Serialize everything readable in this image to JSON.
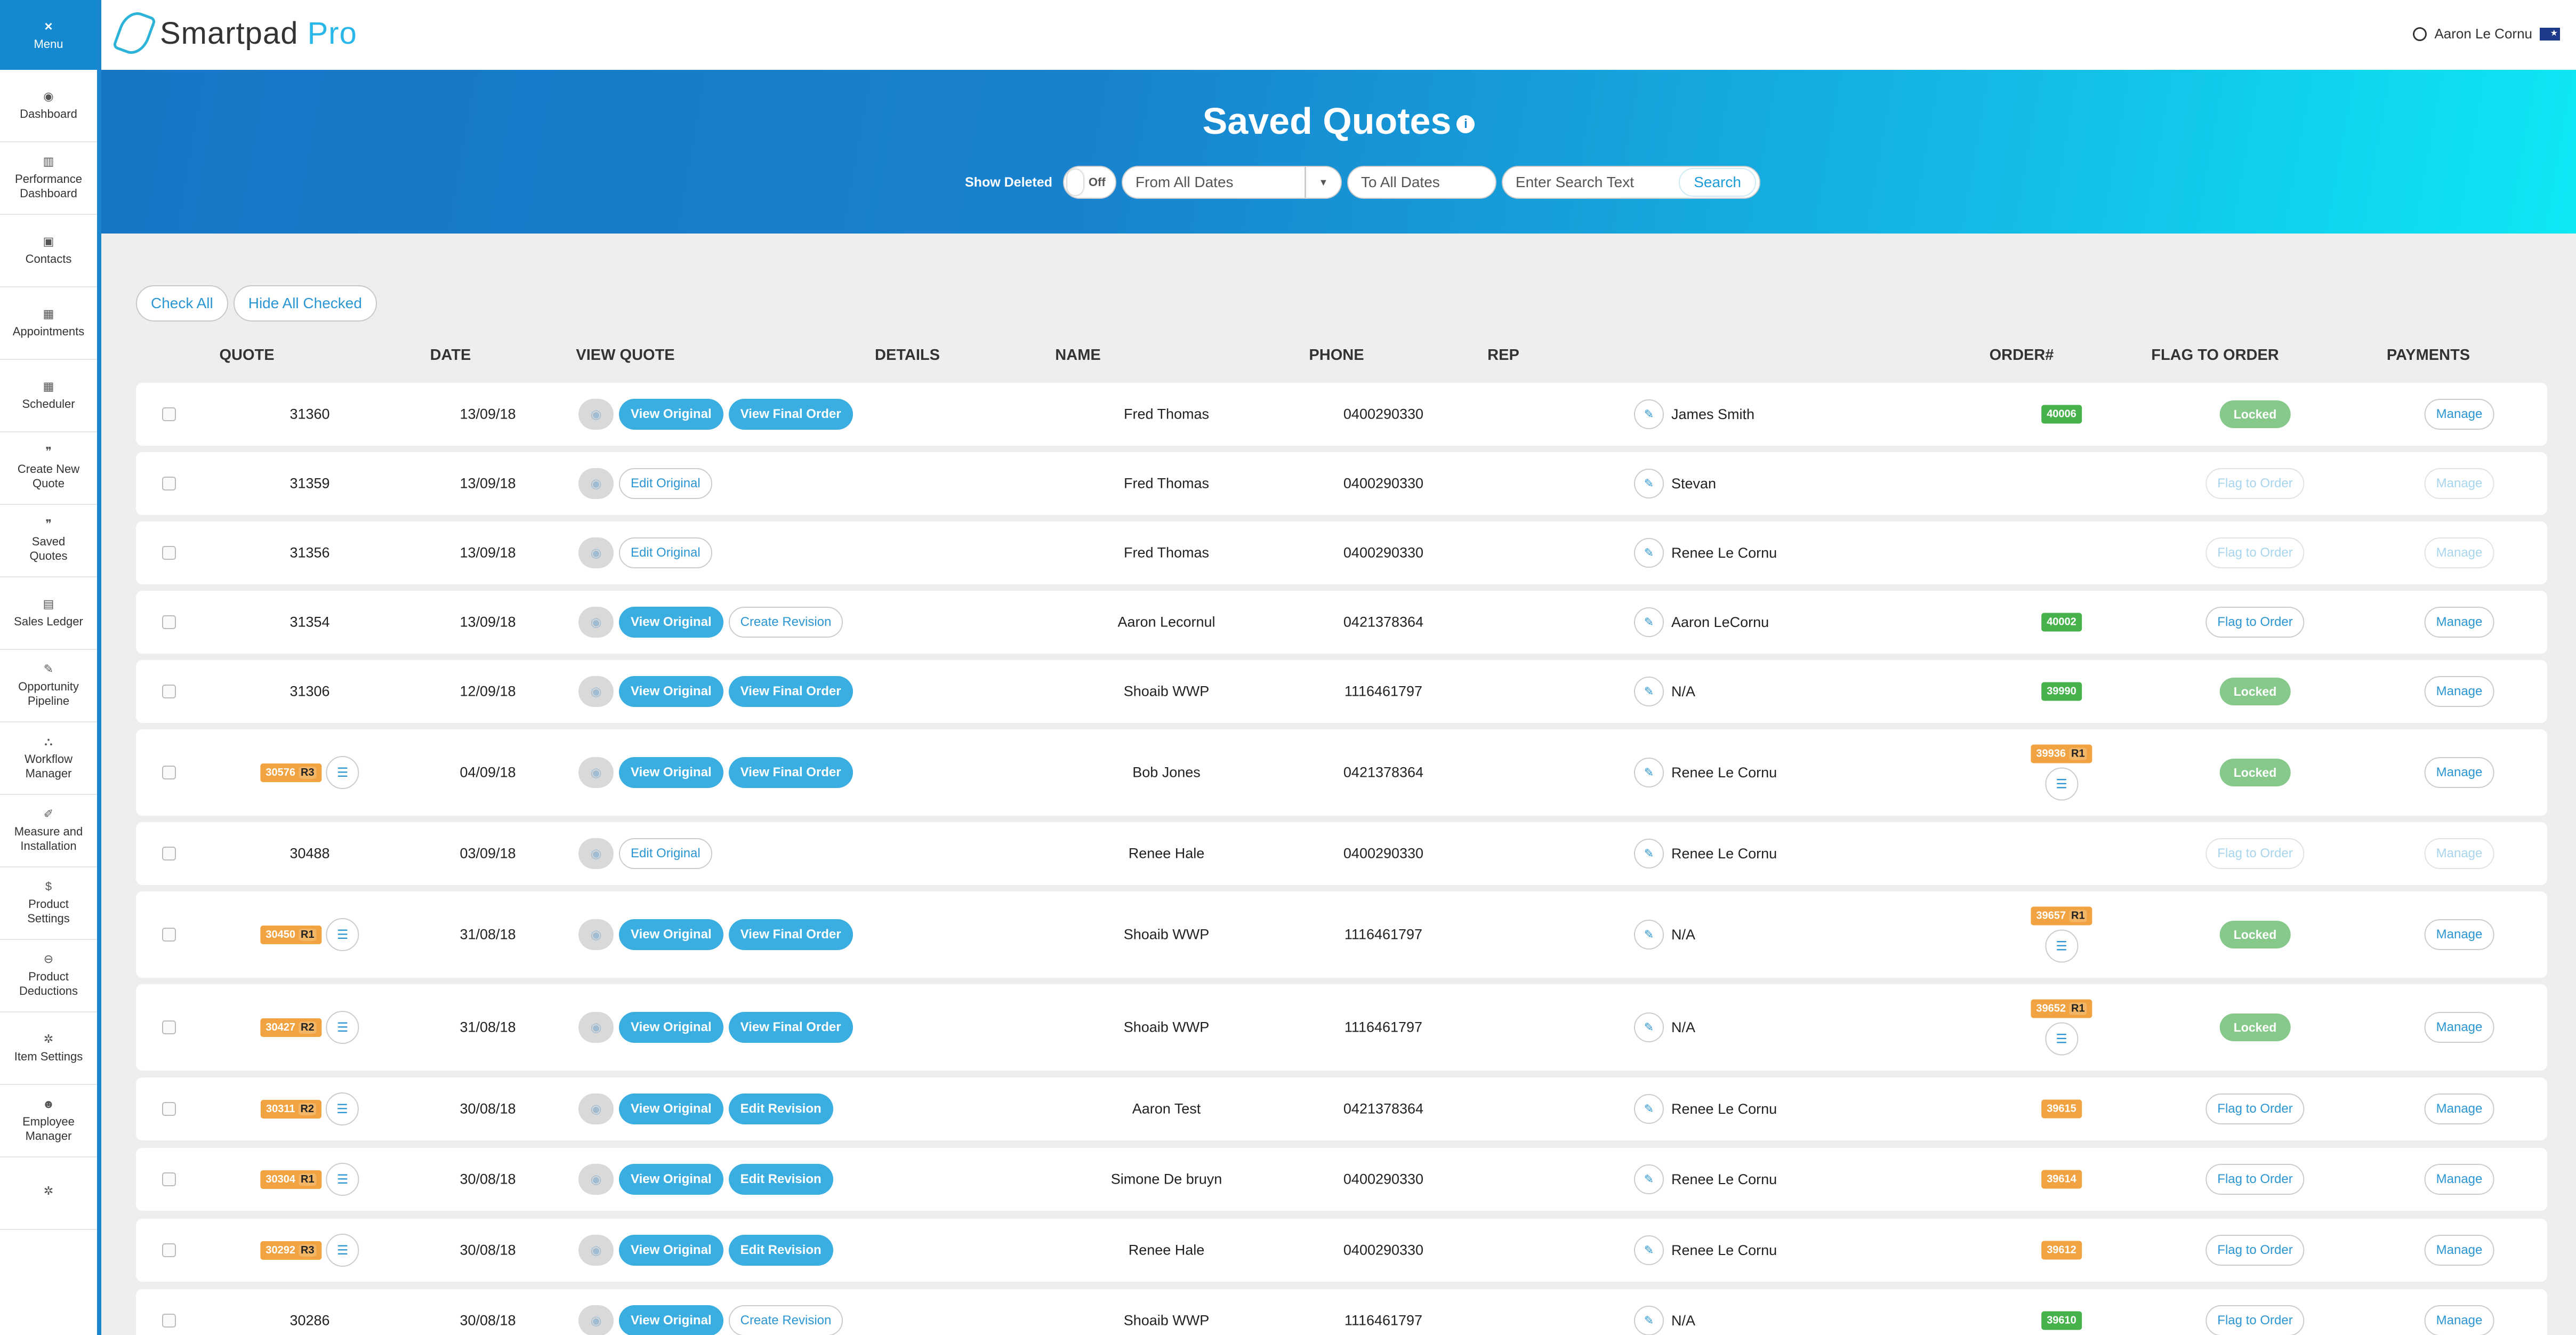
{
  "sidebar": {
    "menu_label": "Menu",
    "items": [
      {
        "label": "Dashboard",
        "icon": "dashboard-icon",
        "glyph": "◉"
      },
      {
        "label": "Performance\nDashboard",
        "icon": "chart-icon",
        "glyph": "▥"
      },
      {
        "label": "Contacts",
        "icon": "contacts-icon",
        "glyph": "▣"
      },
      {
        "label": "Appointments",
        "icon": "calendar-icon",
        "glyph": "▦"
      },
      {
        "label": "Scheduler",
        "icon": "calendar-icon",
        "glyph": "▦"
      },
      {
        "label": "Create New\nQuote",
        "icon": "quote-icon",
        "glyph": "❞"
      },
      {
        "label": "Saved\nQuotes",
        "icon": "quote-icon",
        "glyph": "❞"
      },
      {
        "label": "Sales Ledger",
        "icon": "book-icon",
        "glyph": "▤"
      },
      {
        "label": "Opportunity\nPipeline",
        "icon": "edit-icon",
        "glyph": "✎"
      },
      {
        "label": "Workflow\nManager",
        "icon": "sitemap-icon",
        "glyph": "⛬"
      },
      {
        "label": "Measure and\nInstallation",
        "icon": "wrench-icon",
        "glyph": "✐"
      },
      {
        "label": "Product\nSettings",
        "icon": "dollar-icon",
        "glyph": "$"
      },
      {
        "label": "Product\nDeductions",
        "icon": "minus-circle-icon",
        "glyph": "⊖"
      },
      {
        "label": "Item Settings",
        "icon": "gear-icon",
        "glyph": "✲"
      },
      {
        "label": "Employee\nManager",
        "icon": "users-icon",
        "glyph": "☻"
      },
      {
        "label": "",
        "icon": "gear-icon",
        "glyph": "✲"
      }
    ]
  },
  "topbar": {
    "logo_main": "Smartpad",
    "logo_pro": " Pro",
    "user_name": "Aaron Le Cornu",
    "flag_icon": "australia-flag-icon"
  },
  "banner": {
    "title": "Saved Quotes",
    "show_deleted_label": "Show Deleted",
    "toggle_state": "Off",
    "from_date": "From All Dates",
    "to_date": "To All Dates",
    "search_placeholder": "Enter Search Text",
    "search_button": "Search"
  },
  "toolbar": {
    "check_all": "Check All",
    "hide_all_checked": "Hide All Checked"
  },
  "columns": {
    "quote": "QUOTE",
    "date": "DATE",
    "view_quote": "VIEW QUOTE",
    "details": "DETAILS",
    "name": "NAME",
    "phone": "PHONE",
    "rep": "REP",
    "order": "ORDER#",
    "flag_to_order": "FLAG TO ORDER",
    "payments": "PAYMENTS"
  },
  "rows": [
    {
      "quote": "31360",
      "revision": "",
      "date": "13/09/18",
      "buttons": [
        {
          "label": "View Original",
          "style": "fill"
        },
        {
          "label": "View Final Order",
          "style": "fill"
        }
      ],
      "name": "Fred Thomas",
      "phone": "0400290330",
      "rep": "James Smith",
      "order": "40006",
      "order_color": "green",
      "order_rev": "",
      "flag": "Locked",
      "flag_style": "green",
      "payments": "Manage",
      "payments_dim": false
    },
    {
      "quote": "31359",
      "revision": "",
      "date": "13/09/18",
      "buttons": [
        {
          "label": "Edit Original",
          "style": "out"
        }
      ],
      "name": "Fred Thomas",
      "phone": "0400290330",
      "rep": "Stevan",
      "order": "",
      "order_color": "",
      "order_rev": "",
      "flag": "Flag to Order",
      "flag_style": "dim",
      "payments": "Manage",
      "payments_dim": true
    },
    {
      "quote": "31356",
      "revision": "",
      "date": "13/09/18",
      "buttons": [
        {
          "label": "Edit Original",
          "style": "out"
        }
      ],
      "name": "Fred Thomas",
      "phone": "0400290330",
      "rep": "Renee Le Cornu",
      "order": "",
      "order_color": "",
      "order_rev": "",
      "flag": "Flag to Order",
      "flag_style": "dim",
      "payments": "Manage",
      "payments_dim": true
    },
    {
      "quote": "31354",
      "revision": "",
      "date": "13/09/18",
      "buttons": [
        {
          "label": "View Original",
          "style": "fill"
        },
        {
          "label": "Create Revision",
          "style": "out"
        }
      ],
      "name": "Aaron Lecornul",
      "phone": "0421378364",
      "rep": "Aaron LeCornu",
      "order": "40002",
      "order_color": "green",
      "order_rev": "",
      "flag": "Flag to Order",
      "flag_style": "out",
      "payments": "Manage",
      "payments_dim": false
    },
    {
      "quote": "31306",
      "revision": "",
      "date": "12/09/18",
      "buttons": [
        {
          "label": "View Original",
          "style": "fill"
        },
        {
          "label": "View Final Order",
          "style": "fill"
        }
      ],
      "name": "Shoaib WWP",
      "phone": "1116461797",
      "rep": "N/A",
      "order": "39990",
      "order_color": "green",
      "order_rev": "",
      "flag": "Locked",
      "flag_style": "green",
      "payments": "Manage",
      "payments_dim": false
    },
    {
      "quote": "30576",
      "revision": "R3",
      "date": "04/09/18",
      "buttons": [
        {
          "label": "View Original",
          "style": "fill"
        },
        {
          "label": "View Final Order",
          "style": "fill"
        }
      ],
      "name": "Bob Jones",
      "phone": "0421378364",
      "rep": "Renee Le Cornu",
      "order": "39936",
      "order_color": "orange",
      "order_rev": "R1",
      "flag": "Locked",
      "flag_style": "green",
      "payments": "Manage",
      "payments_dim": false
    },
    {
      "quote": "30488",
      "revision": "",
      "date": "03/09/18",
      "buttons": [
        {
          "label": "Edit Original",
          "style": "out"
        }
      ],
      "name": "Renee Hale",
      "phone": "0400290330",
      "rep": "Renee Le Cornu",
      "order": "",
      "order_color": "",
      "order_rev": "",
      "flag": "Flag to Order",
      "flag_style": "dim",
      "payments": "Manage",
      "payments_dim": true
    },
    {
      "quote": "30450",
      "revision": "R1",
      "date": "31/08/18",
      "buttons": [
        {
          "label": "View Original",
          "style": "fill"
        },
        {
          "label": "View Final Order",
          "style": "fill"
        }
      ],
      "name": "Shoaib WWP",
      "phone": "1116461797",
      "rep": "N/A",
      "order": "39657",
      "order_color": "orange",
      "order_rev": "R1",
      "flag": "Locked",
      "flag_style": "green",
      "payments": "Manage",
      "payments_dim": false
    },
    {
      "quote": "30427",
      "revision": "R2",
      "date": "31/08/18",
      "buttons": [
        {
          "label": "View Original",
          "style": "fill"
        },
        {
          "label": "View Final Order",
          "style": "fill"
        }
      ],
      "name": "Shoaib WWP",
      "phone": "1116461797",
      "rep": "N/A",
      "order": "39652",
      "order_color": "orange",
      "order_rev": "R1",
      "flag": "Locked",
      "flag_style": "green",
      "payments": "Manage",
      "payments_dim": false
    },
    {
      "quote": "30311",
      "revision": "R2",
      "date": "30/08/18",
      "buttons": [
        {
          "label": "View Original",
          "style": "fill"
        },
        {
          "label": "Edit Revision",
          "style": "fill"
        }
      ],
      "name": "Aaron Test",
      "phone": "0421378364",
      "rep": "Renee Le Cornu",
      "order": "39615",
      "order_color": "orange",
      "order_rev": "",
      "flag": "Flag to Order",
      "flag_style": "out",
      "payments": "Manage",
      "payments_dim": false
    },
    {
      "quote": "30304",
      "revision": "R1",
      "date": "30/08/18",
      "buttons": [
        {
          "label": "View Original",
          "style": "fill"
        },
        {
          "label": "Edit Revision",
          "style": "fill"
        }
      ],
      "name": "Simone De bruyn",
      "phone": "0400290330",
      "rep": "Renee Le Cornu",
      "order": "39614",
      "order_color": "orange",
      "order_rev": "",
      "flag": "Flag to Order",
      "flag_style": "out",
      "payments": "Manage",
      "payments_dim": false
    },
    {
      "quote": "30292",
      "revision": "R3",
      "date": "30/08/18",
      "buttons": [
        {
          "label": "View Original",
          "style": "fill"
        },
        {
          "label": "Edit Revision",
          "style": "fill"
        }
      ],
      "name": "Renee Hale",
      "phone": "0400290330",
      "rep": "Renee Le Cornu",
      "order": "39612",
      "order_color": "orange",
      "order_rev": "",
      "flag": "Flag to Order",
      "flag_style": "out",
      "payments": "Manage",
      "payments_dim": false
    },
    {
      "quote": "30286",
      "revision": "",
      "date": "30/08/18",
      "buttons": [
        {
          "label": "View Original",
          "style": "fill"
        },
        {
          "label": "Create Revision",
          "style": "out"
        }
      ],
      "name": "Shoaib WWP",
      "phone": "1116461797",
      "rep": "N/A",
      "order": "39610",
      "order_color": "green",
      "order_rev": "",
      "flag": "Flag to Order",
      "flag_style": "out",
      "payments": "Manage",
      "payments_dim": false
    }
  ]
}
